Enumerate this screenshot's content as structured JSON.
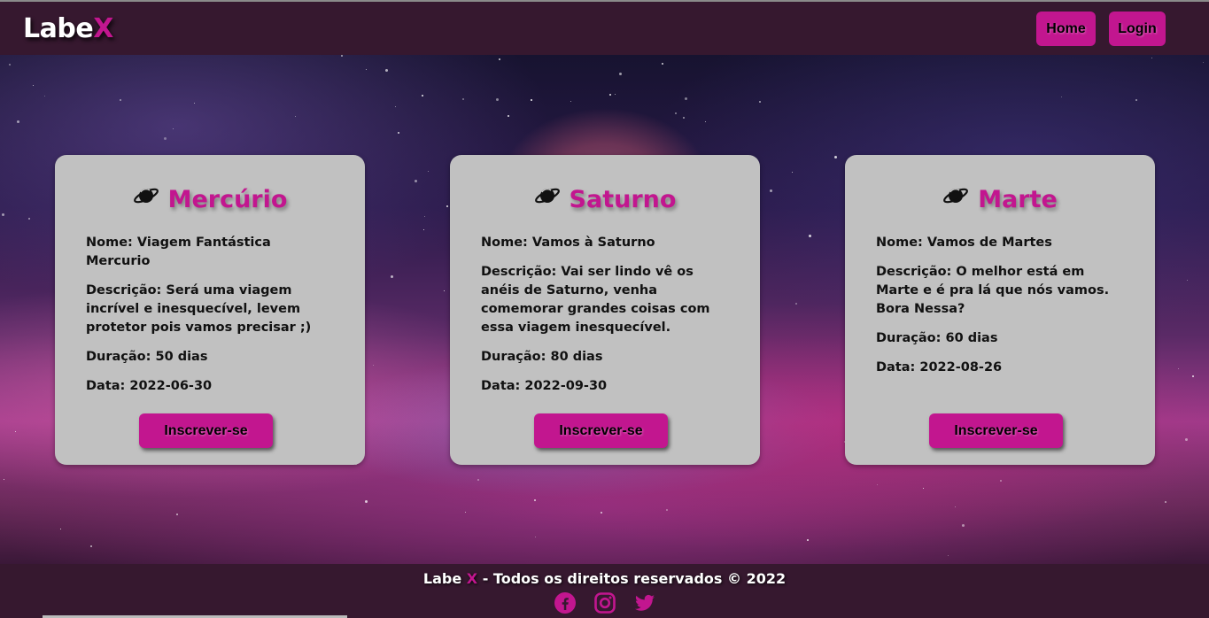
{
  "header": {
    "logo_main": "Labe",
    "logo_accent": "X",
    "nav": {
      "home": "Home",
      "login": "Login"
    }
  },
  "trips": [
    {
      "planet": "Mercúrio",
      "nome": "Nome: Viagem Fantástica Mercurio",
      "descricao": "Descrição: Será uma viagem incrível e inesquecível, levem protetor pois vamos precisar ;)",
      "duracao": "Duração: 50 dias",
      "data": "Data: 2022-06-30",
      "button": "Inscrever-se",
      "icon": "planet-icon"
    },
    {
      "planet": "Saturno",
      "nome": "Nome: Vamos à Saturno",
      "descricao": "Descrição: Vai ser lindo vê os anéis de Saturno, venha comemorar grandes coisas com essa viagem inesquecível.",
      "duracao": "Duração: 80 dias",
      "data": "Data: 2022-09-30",
      "button": "Inscrever-se",
      "icon": "planet-icon"
    },
    {
      "planet": "Marte",
      "nome": "Nome: Vamos de Martes",
      "descricao": "Descrição: O melhor está em Marte e é pra lá que nós vamos. Bora Nessa?",
      "duracao": "Duração: 60 dias",
      "data": "Data: 2022-08-26",
      "button": "Inscrever-se",
      "icon": "planet-icon"
    }
  ],
  "footer": {
    "brand_main": "Labe",
    "brand_accent": "X",
    "rights": "- Todos os direitos reservados © 2022",
    "socials": [
      "facebook-icon",
      "instagram-icon",
      "twitter-icon"
    ]
  },
  "colors": {
    "accent": "#c2168f",
    "header_bg": "#36182f",
    "card_bg": "#c1c1c1"
  }
}
